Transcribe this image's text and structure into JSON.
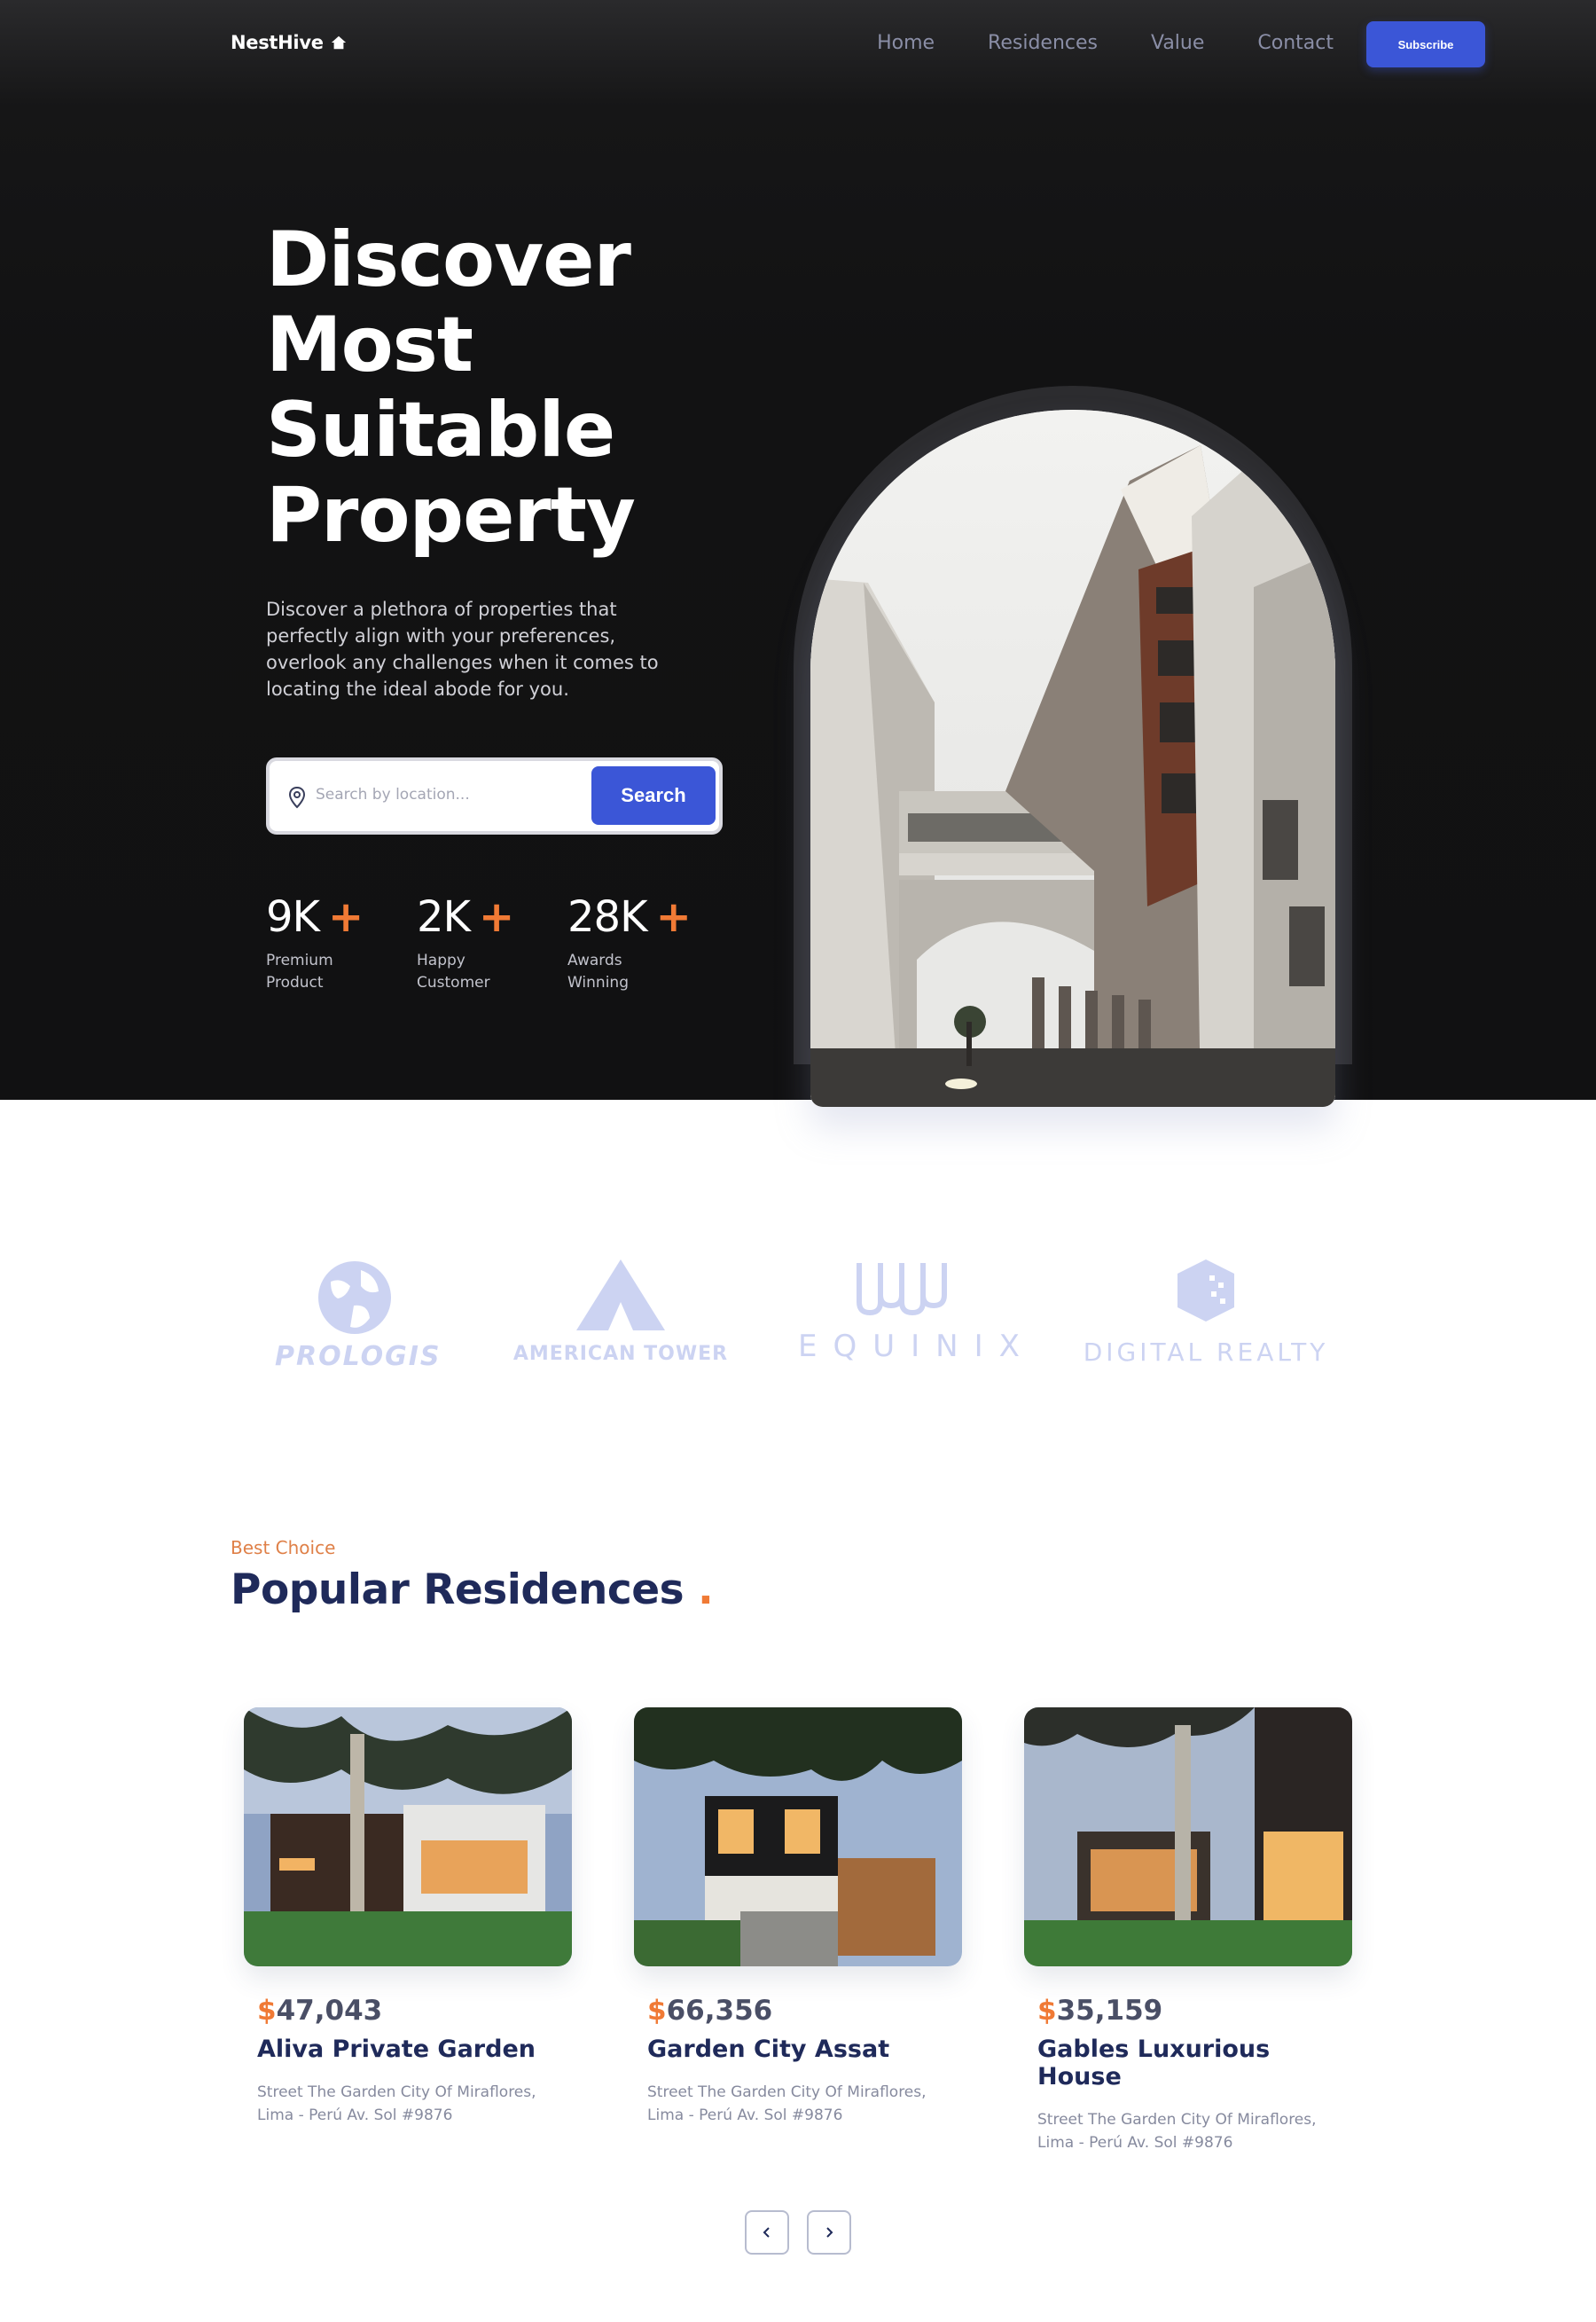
{
  "brand": {
    "name": "NestHive"
  },
  "nav": {
    "links": [
      "Home",
      "Residences",
      "Value",
      "Contact"
    ],
    "subscribe_label": "Subscribe"
  },
  "hero": {
    "title_lines": [
      "Discover",
      "Most",
      "Suitable",
      "Property"
    ],
    "description": "Discover a plethora of properties that perfectly align with your preferences, overlook any challenges when it comes to locating the ideal abode for you.",
    "search_placeholder": "Search by location...",
    "search_button": "Search",
    "stats": [
      {
        "value": "9K",
        "plus": "+",
        "label": "Premium Product"
      },
      {
        "value": "2K",
        "plus": "+",
        "label": "Happy Customer"
      },
      {
        "value": "28K",
        "plus": "+",
        "label": "Awards Winning"
      }
    ]
  },
  "partners": [
    "PROLOGIS",
    "AMERICAN TOWER",
    "EQUINIX",
    "DIGITAL REALTY"
  ],
  "residences": {
    "eyebrow": "Best Choice",
    "title": "Popular Residences",
    "title_dot": ".",
    "cards": [
      {
        "currency": "$",
        "price": "47,043",
        "name": "Aliva Private Garden",
        "address": "Street The Garden City Of Miraflores, Lima - Perú Av. Sol #9876"
      },
      {
        "currency": "$",
        "price": "66,356",
        "name": "Garden City Assat",
        "address": "Street The Garden City Of Miraflores, Lima - Perú Av. Sol #9876"
      },
      {
        "currency": "$",
        "price": "35,159",
        "name": "Gables Luxurious House",
        "address": "Street The Garden City Of Miraflores, Lima - Perú Av. Sol #9876"
      }
    ]
  },
  "colors": {
    "accent_blue": "#3b56d7",
    "accent_orange": "#f07a35",
    "navy_text": "#1f2a5a",
    "hero_bg": "#121213"
  },
  "icons": [
    "home-icon",
    "location-pin-icon",
    "chevron-left-icon",
    "chevron-right-icon"
  ]
}
